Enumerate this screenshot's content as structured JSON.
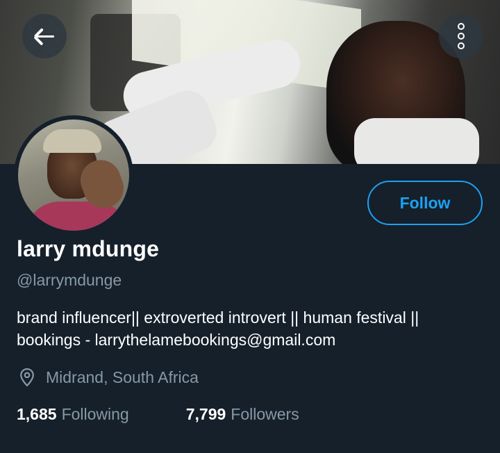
{
  "profile": {
    "name": "larry mdunge",
    "handle": "@larrymdunge",
    "bio_line1": "brand influencer|| extroverted introvert || human festival ||",
    "bio_line2": "bookings - larrythelamebookings@gmail.com",
    "location": "Midrand, South Africa"
  },
  "actions": {
    "follow_label": "Follow"
  },
  "stats": {
    "following_count": "1,685",
    "following_label": "Following",
    "followers_count": "7,799",
    "followers_label": "Followers"
  },
  "icons": {
    "back": "back-arrow-icon",
    "more": "more-vertical-icon",
    "location": "location-pin-icon"
  },
  "colors": {
    "background": "#15202b",
    "accent": "#1da1f2",
    "secondary_text": "#8899a6"
  }
}
